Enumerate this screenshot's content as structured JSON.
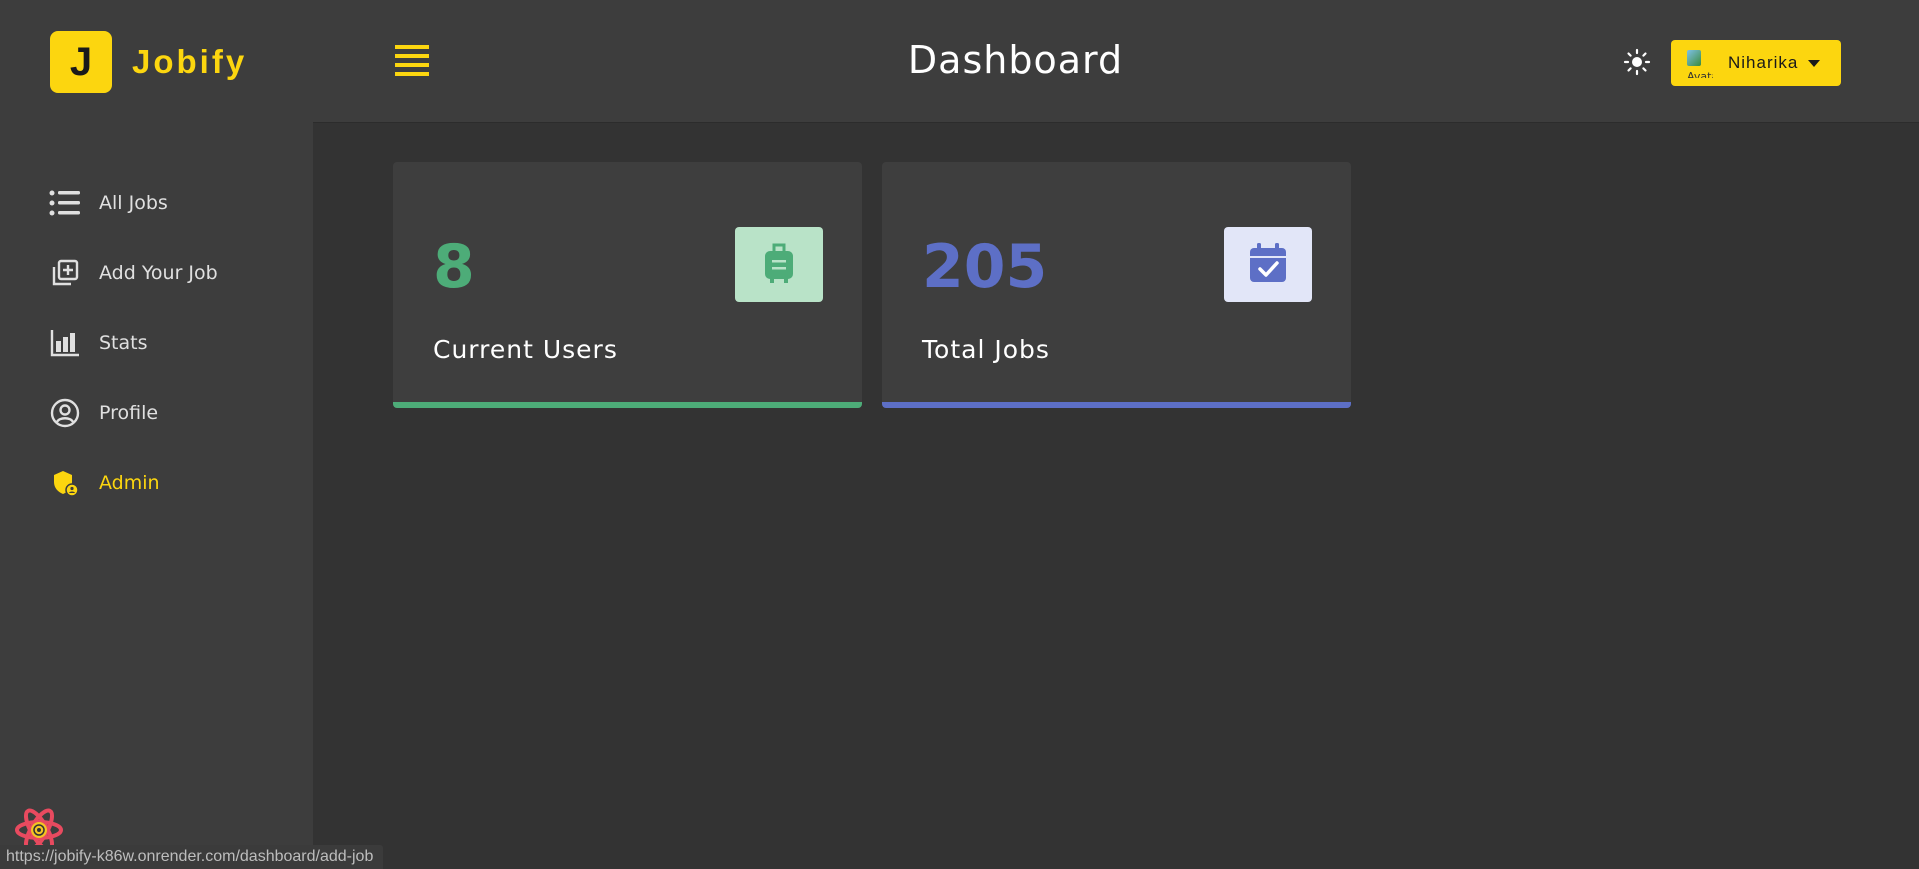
{
  "app": {
    "name": "Jobify",
    "logo_letter": "J"
  },
  "header": {
    "title": "Dashboard",
    "user": {
      "name": "Niharika",
      "avatar_alt": "Avatar"
    },
    "theme_icon": "sun-icon",
    "menu_icon": "hamburger-icon"
  },
  "sidebar": {
    "items": [
      {
        "label": "All Jobs",
        "icon": "list-icon",
        "active": false
      },
      {
        "label": "Add Your Job",
        "icon": "add-box-icon",
        "active": false
      },
      {
        "label": "Stats",
        "icon": "bar-chart-icon",
        "active": false
      },
      {
        "label": "Profile",
        "icon": "user-circle-icon",
        "active": false
      },
      {
        "label": "Admin",
        "icon": "shield-user-icon",
        "active": true
      }
    ]
  },
  "stats": [
    {
      "count": "8",
      "label": "Current Users",
      "icon": "suitcase-icon",
      "color": "#4dac78",
      "bg": "#b9e3c8"
    },
    {
      "count": "205",
      "label": "Total Jobs",
      "icon": "calendar-check-icon",
      "color": "#5d6fc6",
      "bg": "#e2e6f8"
    }
  ],
  "status_bar": {
    "url": "https://jobify-k86w.onrender.com/dashboard/add-job"
  },
  "colors": {
    "accent": "#fcd60f",
    "sidebar_bg": "#3d3d3d",
    "main_bg": "#333333"
  }
}
